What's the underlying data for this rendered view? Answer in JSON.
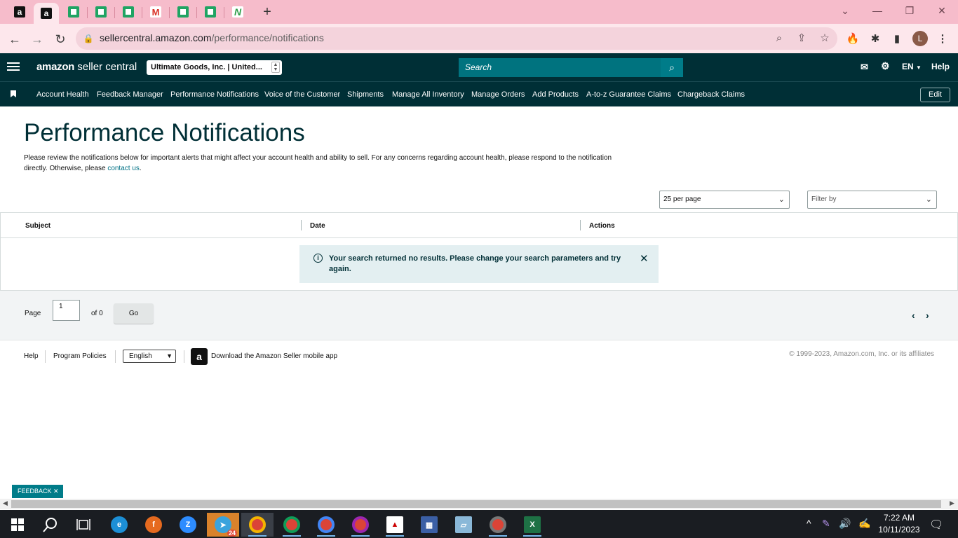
{
  "browser": {
    "url_host": "sellercentral.amazon.com",
    "url_path": "/performance/notifications",
    "window_controls": [
      "⌄",
      "—",
      "❐",
      "✕"
    ]
  },
  "header": {
    "logo_bold": "amazon",
    "logo_rest": " seller central",
    "account": "Ultimate Goods, Inc. | United...",
    "search_placeholder": "Search",
    "language": "EN",
    "help": "Help"
  },
  "nav": {
    "items": [
      "Account Health",
      "Feedback Manager",
      "Performance Notifications",
      "Voice of the Customer",
      "Shipments",
      "Manage All Inventory",
      "Manage Orders",
      "Add Products",
      "A-to-z Guarantee Claims",
      "Chargeback Claims"
    ],
    "edit": "Edit"
  },
  "page": {
    "title": "Performance Notifications",
    "intro": "Please review the notifications below for important alerts that might affect your account health and ability to sell. For any concerns regarding account health, please respond to the notification directly. Otherwise, please ",
    "intro_link": "contact us",
    "intro_end": ".",
    "per_page": "25 per page",
    "filter_placeholder": "Filter by"
  },
  "table": {
    "columns": [
      "Subject",
      "Date",
      "Actions"
    ],
    "no_results": "Your search returned no results. Please change your search parameters and try again."
  },
  "pager": {
    "page_label": "Page",
    "page_value": "1",
    "of_label": "of 0",
    "go": "Go"
  },
  "footer": {
    "help": "Help",
    "policies": "Program Policies",
    "language": "English",
    "app_text": "Download the Amazon Seller mobile app",
    "copyright": "© 1999-2023, Amazon.com, Inc. or its affiliates"
  },
  "feedback": "FEEDBACK",
  "taskbar": {
    "time": "7:22 AM",
    "date": "10/11/2023",
    "badge": "24"
  }
}
